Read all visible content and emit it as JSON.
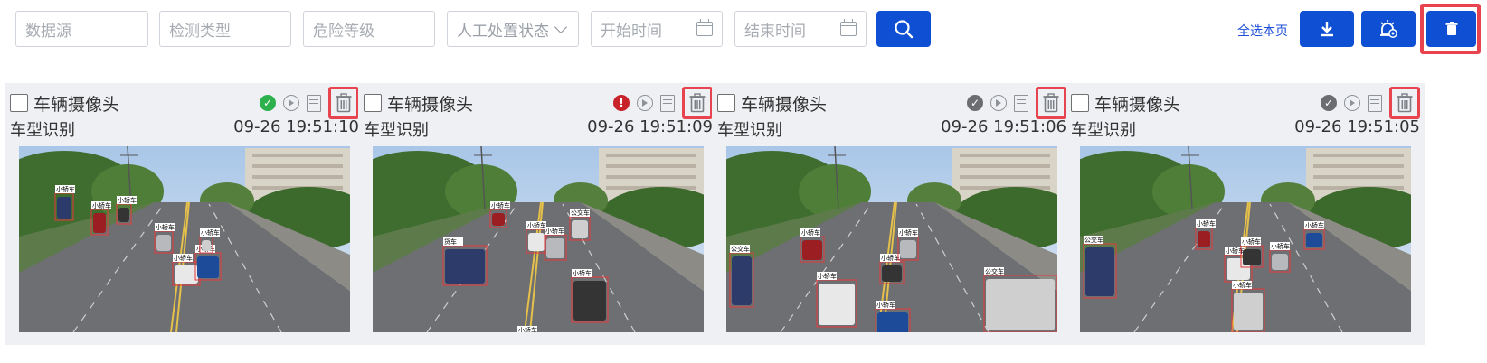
{
  "filters": {
    "data_source_placeholder": "数据源",
    "detect_type_placeholder": "检测类型",
    "risk_level_placeholder": "危险等级",
    "manual_status_label": "人工处置状态",
    "start_time_placeholder": "开始时间",
    "end_time_placeholder": "结束时间"
  },
  "actions": {
    "select_all_label": "全选本页"
  },
  "colors": {
    "accent": "#0f4fd3",
    "highlight": "#e7444f",
    "ok": "#2db14c",
    "warn": "#c8222a",
    "done": "#6b6d70"
  },
  "cards": [
    {
      "camera": "车辆摄像头",
      "type": "车型识别",
      "time": "09-26 19:51:10",
      "status": "ok-icon",
      "labels": [
        "小轿车",
        "小轿车",
        "小轿车",
        "小轿车",
        "小轿车",
        "小轿车",
        "小轿车"
      ]
    },
    {
      "camera": "车辆摄像头",
      "type": "车型识别",
      "time": "09-26 19:51:09",
      "status": "warning-icon",
      "labels": [
        "货车",
        "小轿车",
        "小轿车",
        "小轿车",
        "小轿车",
        "小轿车",
        "公交车"
      ]
    },
    {
      "camera": "车辆摄像头",
      "type": "车型识别",
      "time": "09-26 19:51:06",
      "status": "done-icon",
      "labels": [
        "公交车",
        "小轿车",
        "小轿车",
        "小轿车",
        "小轿车",
        "小轿车",
        "公交车"
      ]
    },
    {
      "camera": "车辆摄像头",
      "type": "车型识别",
      "time": "09-26 19:51:05",
      "status": "done-icon",
      "labels": [
        "公交车",
        "小轿车",
        "小轿车",
        "小轿车",
        "小轿车",
        "小轿车",
        "小轿车"
      ]
    }
  ]
}
